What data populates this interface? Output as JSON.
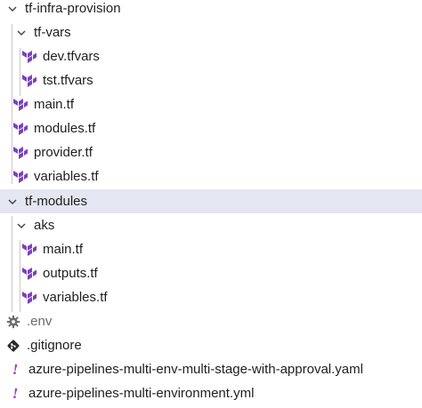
{
  "explorer": {
    "items": [
      {
        "label": "tf-infra-provision",
        "type": "folder-open"
      },
      {
        "label": "tf-vars",
        "type": "folder-open"
      },
      {
        "label": "dev.tfvars",
        "type": "terraform"
      },
      {
        "label": "tst.tfvars",
        "type": "terraform"
      },
      {
        "label": "main.tf",
        "type": "terraform"
      },
      {
        "label": "modules.tf",
        "type": "terraform"
      },
      {
        "label": "provider.tf",
        "type": "terraform"
      },
      {
        "label": "variables.tf",
        "type": "terraform"
      },
      {
        "label": "tf-modules",
        "type": "folder-open",
        "selected": true
      },
      {
        "label": "aks",
        "type": "folder-open"
      },
      {
        "label": "main.tf",
        "type": "terraform"
      },
      {
        "label": "outputs.tf",
        "type": "terraform"
      },
      {
        "label": "variables.tf",
        "type": "terraform"
      },
      {
        "label": ".env",
        "type": "env"
      },
      {
        "label": ".gitignore",
        "type": "git"
      },
      {
        "label": "azure-pipelines-multi-env-multi-stage-with-approval.yaml",
        "type": "yaml"
      },
      {
        "label": "azure-pipelines-multi-environment.yml",
        "type": "yaml"
      }
    ]
  },
  "colors": {
    "terraform_icon": "#7b42bc",
    "yaml_icon": "#9b36c4",
    "selected_row": "#e4e6f1",
    "muted_text": "#6a6a6a"
  }
}
